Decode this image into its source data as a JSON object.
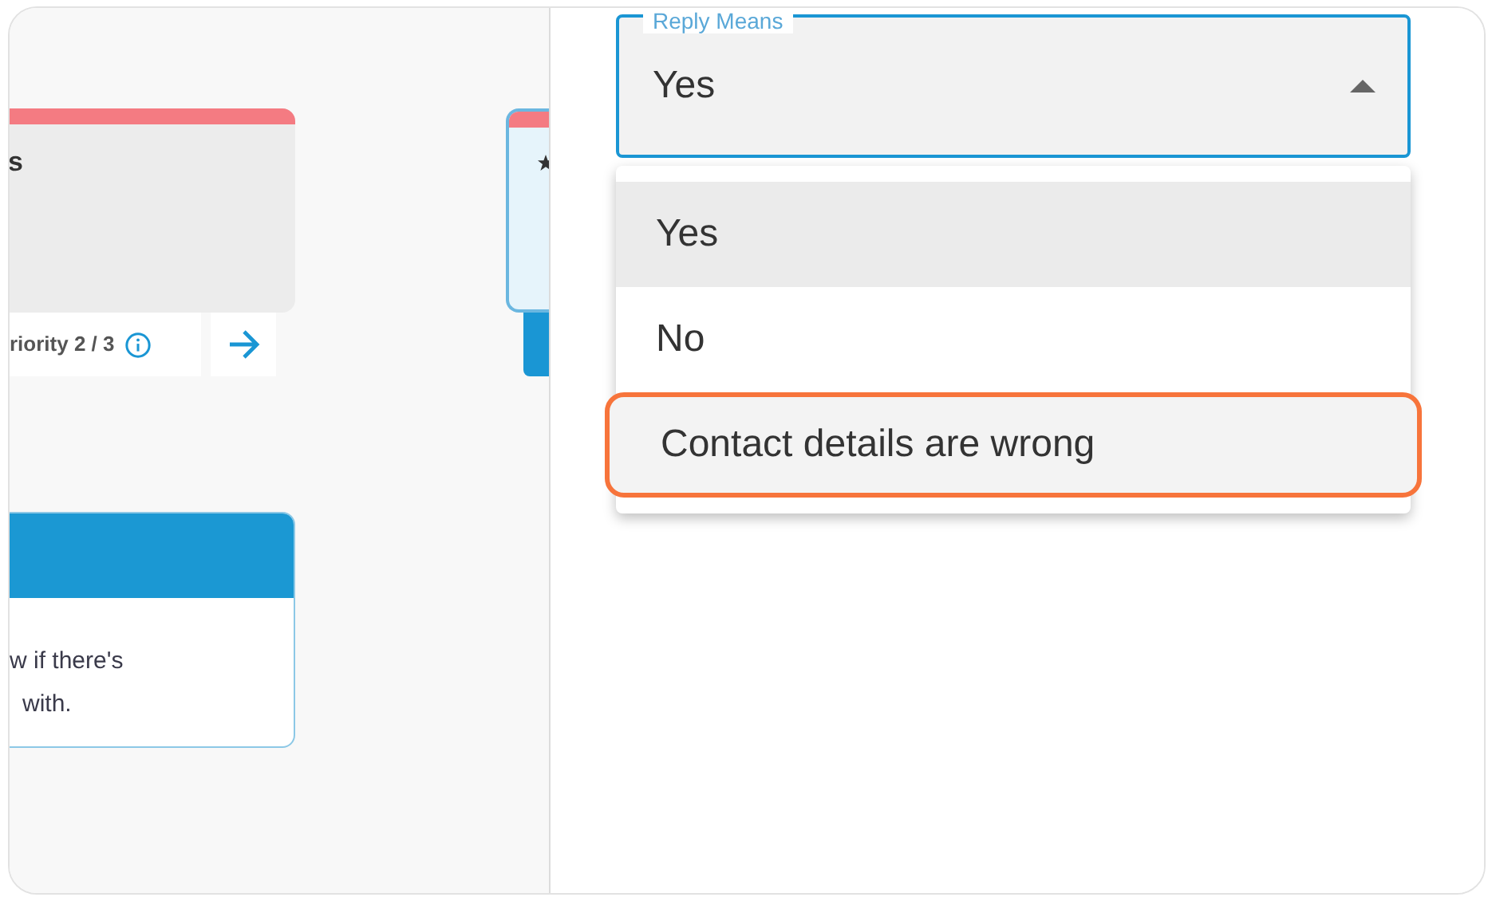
{
  "canvas": {
    "cards": [
      {
        "kind": "task",
        "title": "s",
        "footer": "riority 2 / 3"
      },
      {
        "kind": "peek"
      },
      {
        "kind": "message",
        "body": [
          "w if there's",
          "with."
        ]
      }
    ]
  },
  "select": {
    "label": "Reply Means",
    "value": "Yes",
    "expanded": true,
    "options": [
      {
        "label": "Yes",
        "selected": true,
        "highlighted": false
      },
      {
        "label": "No",
        "selected": false,
        "highlighted": false
      },
      {
        "label": "Contact details are wrong",
        "selected": false,
        "highlighted": true
      }
    ]
  }
}
